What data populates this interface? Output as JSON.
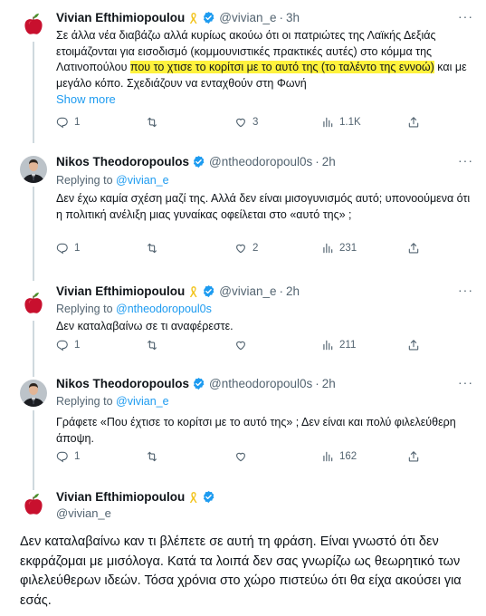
{
  "tweets": [
    {
      "name": "Vivian Efthimiopoulou",
      "handle": "@vivian_e",
      "time": "3h",
      "text_before": "Σε άλλα νέα διαβάζω αλλά κυρίως ακούω ότι οι πατριώτες της Λαϊκής Δεξιάς ετοιμάζονται για εισοδισμό (κομμουνιστικές πρακτικές αυτές) στο κόμμα της Λατινοπούλου ",
      "text_highlight": "που το χτισε το κορίτσι με το αυτό της (το ταλέντο της εννοώ)",
      "text_after": " και με μεγάλο κόπο. Σχεδιάζουν να ενταχθούν στη Φωνή",
      "show_more": "Show more",
      "replies": "1",
      "retweets": "",
      "likes": "3",
      "views": "1.1K"
    },
    {
      "name": "Nikos Theodoropoulos",
      "handle": "@ntheodoropoul0s",
      "time": "2h",
      "replying_prefix": "Replying to ",
      "replying_to": "@vivian_e",
      "text": "Δεν έχω καμία σχέση μαζί της. Αλλά δεν είναι μισογυνισμός αυτό; υπονοούμενα ότι η πολιτική ανέλιξη μιας γυναίκας οφείλεται στο «αυτό της» ;",
      "replies": "1",
      "retweets": "",
      "likes": "2",
      "views": "231"
    },
    {
      "name": "Vivian Efthimiopoulou",
      "handle": "@vivian_e",
      "time": "2h",
      "replying_prefix": "Replying to ",
      "replying_to": "@ntheodoropoul0s",
      "text": "Δεν καταλαβαίνω σε τι αναφέρεστε.",
      "replies": "1",
      "retweets": "",
      "likes": "",
      "views": "211"
    },
    {
      "name": "Nikos Theodoropoulos",
      "handle": "@ntheodoropoul0s",
      "time": "2h",
      "replying_prefix": "Replying to ",
      "replying_to": "@vivian_e",
      "text": "Γράφετε «Που έχτισε το κορίτσι με το αυτό της» ; Δεν είναι και πολύ φιλελεύθερη άποψη.",
      "replies": "1",
      "retweets": "",
      "likes": "",
      "views": "162"
    },
    {
      "name": "Vivian Efthimiopoulou",
      "handle": "@vivian_e",
      "text": "Δεν καταλαβαίνω καν τι βλέπετε σε αυτή τη φράση. Είναι γνωστό ότι δεν εκφράζομαι με μισόλογα. Κατά τα λοιπά δεν σας γνωρίζω ως θεωρητικό των φιλελεύθερων ιδεών. Τόσα χρόνια στο χώρο πιστεύω ότι θα είχα ακούσει για εσάς."
    }
  ],
  "icons": {
    "more": "more-dots-icon",
    "reply": "reply-icon",
    "retweet": "retweet-icon",
    "like": "heart-icon",
    "views": "views-icon",
    "share": "share-icon",
    "verified": "verified-badge-icon",
    "ribbon": "yellow-ribbon-icon"
  },
  "colors": {
    "link": "#1d9bf0",
    "secondary": "#536471",
    "highlight": "#fff23d",
    "verified": "#1d9bf0"
  }
}
